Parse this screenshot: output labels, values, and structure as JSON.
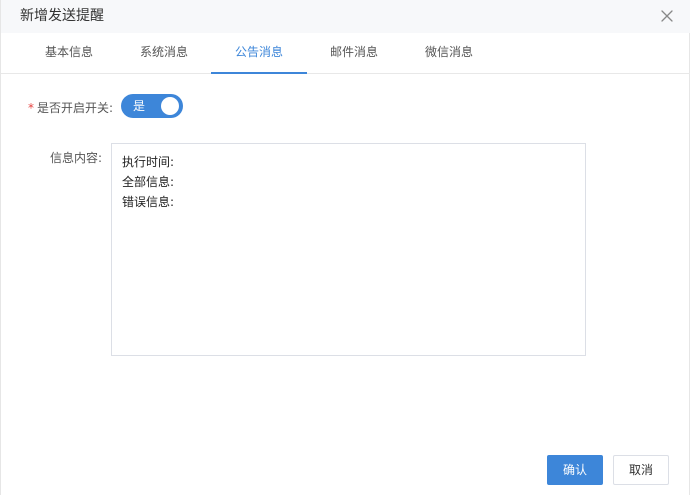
{
  "dialog": {
    "title": "新增发送提醒",
    "close_icon": "close-icon"
  },
  "tabs": [
    {
      "label": "基本信息",
      "active": false
    },
    {
      "label": "系统消息",
      "active": false
    },
    {
      "label": "公告消息",
      "active": true
    },
    {
      "label": "邮件消息",
      "active": false
    },
    {
      "label": "微信消息",
      "active": false
    }
  ],
  "form": {
    "switch_required_mark": "*",
    "switch_label": "是否开启开关:",
    "switch_value_text": "是",
    "switch_on": true,
    "content_label": "信息内容:",
    "content_lines": [
      "执行时间:",
      "全部信息:",
      "错误信息:"
    ]
  },
  "buttons": {
    "ok": "确认",
    "cancel": "取消"
  },
  "colors": {
    "accent": "#3d86d9",
    "required": "#e64340",
    "title_bar_bg": "#f7f8fa"
  }
}
